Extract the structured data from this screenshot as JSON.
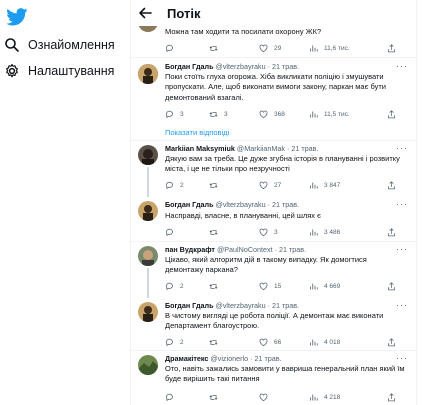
{
  "sidebar": {
    "logo_icon": "twitter-bird-icon",
    "brand_color": "#1d9bf0",
    "items": [
      {
        "icon": "hashtag-icon",
        "label": "Ознайомлення"
      },
      {
        "icon": "gear-icon",
        "label": "Налаштування"
      }
    ]
  },
  "header": {
    "title": "Потік"
  },
  "top_tweet": {
    "text": "Можна там ходити та посилати охорону ЖК?",
    "stats": {
      "reply": "",
      "retweet": "",
      "like": "29",
      "views": "11,6 тис."
    }
  },
  "tweets": [
    {
      "name": "Богдан Гдаль",
      "handle": "@vlterzbayraku · 21 трав.",
      "text": "Поки стоїть глуха огорожа. Хіба викликати поліцію і змушувати пропускати. Але, щоб виконати вимоги закону, паркан має бути демонтований взагалі.",
      "stats": {
        "reply": "3",
        "retweet": "3",
        "like": "368",
        "views": "11,5 тис."
      }
    },
    {
      "name": "Markiian Maksymiuk",
      "handle": "@MarkiianMak · 21 трав.",
      "text": "Дякую вам за треба. Це дуже згубна історія в плануванні і розвитку міста, і це не тільки про незручності",
      "stats": {
        "reply": "2",
        "retweet": "",
        "like": "27",
        "views": "3 847"
      }
    },
    {
      "name": "Богдан Гдаль",
      "handle": "@vlterzbayraku · 21 трав.",
      "text": "Насправді, власне, в плануванні, цей шлях є",
      "stats": {
        "reply": "",
        "retweet": "",
        "like": "3",
        "views": "3 486"
      }
    },
    {
      "name": "пан Вудкрафт",
      "handle": "@PaulNoContext · 21 трав.",
      "text": "Цікаво, який алгоритм дій в такому випадку. Як домогтися демонтажу паркана?",
      "stats": {
        "reply": "2",
        "retweet": "",
        "like": "15",
        "views": "4 669"
      }
    },
    {
      "name": "Богдан Гдаль",
      "handle": "@vlterzbayraku · 21 трав.",
      "text": "В чистому вигляді це робота поліції. А демонтаж має виконати Департамент благоустрою.",
      "stats": {
        "reply": "2",
        "retweet": "",
        "like": "66",
        "views": "4 018"
      }
    },
    {
      "name": "Дрaмaкітекс",
      "handle": "@vizionerlo · 21 трав.",
      "text": "Ото, навіть зажались замовити у вавриша генеральний план який їм буде вирішить такі питання",
      "stats": {
        "reply": "",
        "retweet": "",
        "like": "",
        "views": "4 218"
      }
    }
  ],
  "show_replies": "Показати відповіді"
}
